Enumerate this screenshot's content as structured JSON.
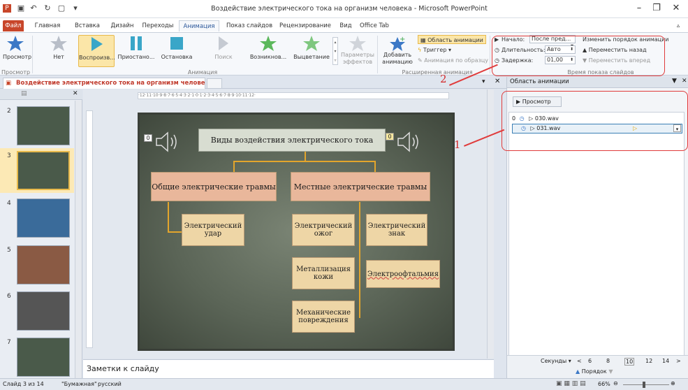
{
  "window": {
    "title": "Воздействие электрического тока на организм человека - Microsoft PowerPoint"
  },
  "tabs": [
    "Файл",
    "Главная",
    "Вставка",
    "Дизайн",
    "Переходы",
    "Анимация",
    "Показ слайдов",
    "Рецензирование",
    "Вид",
    "Office Tab"
  ],
  "ribbon": {
    "preview": "Просмотр",
    "preview_group": "Просмотр",
    "anim_none": "Нет",
    "anim_play": "Воспроизв...",
    "anim_pause": "Приостано...",
    "anim_stop": "Остановка",
    "anim_seek": "Поиск",
    "anim_appear": "Возникнов...",
    "anim_fade": "Выцветание",
    "effect_params": "Параметры эффектов",
    "animation_group": "Анимация",
    "add_animation": "Добавить анимацию",
    "anim_pane": "Область анимации",
    "trigger": "Триггер",
    "anim_painter": "Анимация по образцу",
    "advanced_group": "Расширенная анимация",
    "start_label": "Начало:",
    "start_value": "После пред...",
    "duration_label": "Длительность:",
    "duration_value": "Авто",
    "delay_label": "Задержка:",
    "delay_value": "01,00",
    "reorder_title": "Изменить порядок анимации",
    "move_back": "Переместить назад",
    "move_forward": "Переместить вперед",
    "timing_group": "Время показа слайдов"
  },
  "doc_tab": "Воздействие электрического тока на организм человека",
  "thumbnails": [
    {
      "num": "2"
    },
    {
      "num": "3"
    },
    {
      "num": "4"
    },
    {
      "num": "5"
    },
    {
      "num": "6"
    },
    {
      "num": "7"
    }
  ],
  "slide": {
    "title": "Виды воздействия электрического тока",
    "general": "Общие электрические травмы",
    "local": "Местные электрические травмы",
    "shock": "Электрический удар",
    "burn": "Электрический ожог",
    "sign": "Электрический знак",
    "metal": "Металлизация кожи",
    "ophth": "Электроофтальмия",
    "mech": "Механические повреждения",
    "badge_left": "0",
    "badge_right": "0"
  },
  "notes": "Заметки к слайду",
  "pane": {
    "title": "Область анимации",
    "preview": "Просмотр",
    "items": [
      {
        "order": "0",
        "name": "030.wav"
      },
      {
        "order": "",
        "name": "031.wav"
      }
    ],
    "seconds": "Секунды",
    "ticks": [
      "6",
      "8",
      "10",
      "12",
      "14"
    ],
    "order": "Порядок"
  },
  "status": {
    "slide": "Слайд 3 из 14",
    "theme": "\"Бумажная\"",
    "lang": "русский",
    "zoom": "66%"
  },
  "annotations": {
    "one": "1",
    "two": "2"
  }
}
